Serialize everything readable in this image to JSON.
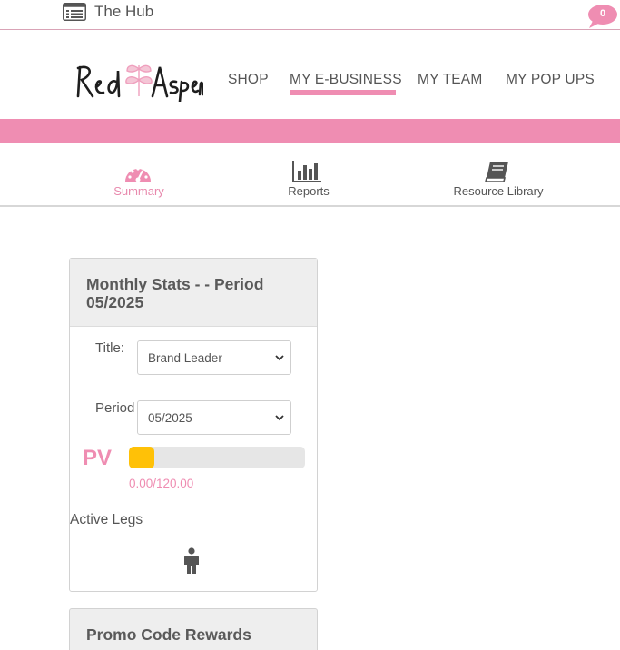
{
  "topbar": {
    "hub_label": "The Hub",
    "notification_count": "0"
  },
  "header": {
    "logo_text": "Red Aspen",
    "nav": [
      "SHOP",
      "MY E-BUSINESS",
      "MY TEAM",
      "MY POP UPS"
    ],
    "active_nav": "MY E-BUSINESS"
  },
  "subtabs": {
    "items": [
      "Summary",
      "Reports",
      "Resource Library"
    ],
    "active": "Summary"
  },
  "monthly_stats": {
    "title": "Monthly Stats - - Period 05/2025",
    "title_label": "Title:",
    "title_value": "Brand Leader",
    "period_label": "Period",
    "period_value": "05/2025",
    "pv_label": "PV",
    "pv_value": "0.00/120.00",
    "pv_progress": 0.0,
    "active_legs_label": "Active Legs"
  },
  "promo_card": {
    "title": "Promo Code Rewards"
  },
  "colors": {
    "brand_pink": "#ef8db2",
    "progress_yellow": "#ffc107"
  },
  "icons": {
    "hub": "list-icon",
    "notification": "speech-bubble-icon",
    "summary": "dashboard-gauge-icon",
    "reports": "bar-chart-icon",
    "library": "book-icon",
    "legs": "person-icon"
  }
}
